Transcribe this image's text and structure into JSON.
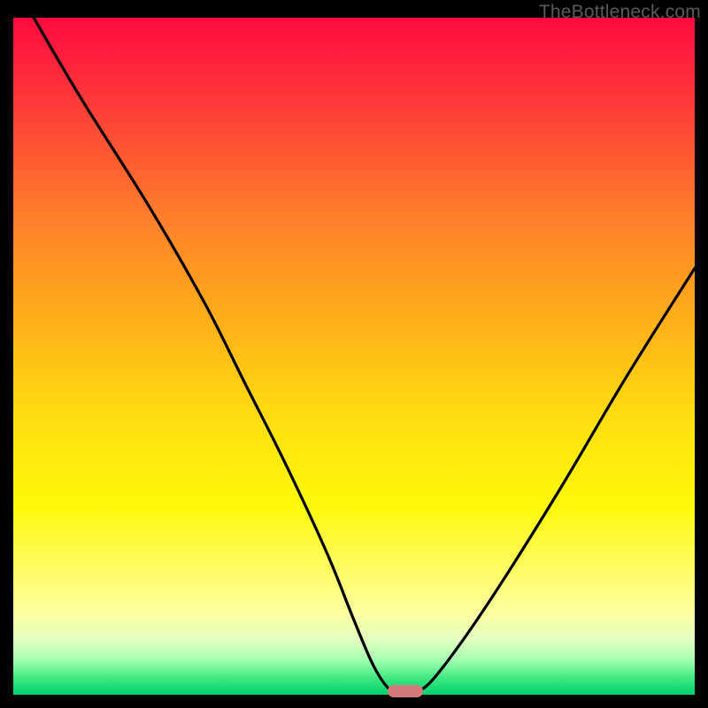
{
  "watermark": "TheBottleneck.com",
  "colors": {
    "gradient_top": "#ff0a3e",
    "gradient_bottom": "#00d070",
    "curve": "#000000",
    "marker": "#d47a7c",
    "frame": "#000000"
  },
  "chart_data": {
    "type": "line",
    "title": "",
    "xlabel": "",
    "ylabel": "",
    "xlim": [
      0,
      100
    ],
    "ylim": [
      0,
      100
    ],
    "grid": false,
    "series": [
      {
        "name": "bottleneck-curve",
        "x": [
          3,
          10,
          20,
          28,
          34,
          40,
          46,
          50,
          53,
          55.5,
          57,
          59.5,
          63,
          70,
          80,
          90,
          100
        ],
        "y": [
          100,
          88,
          72,
          58,
          46,
          34,
          21,
          11,
          4,
          0.5,
          0.5,
          0.5,
          4,
          14,
          30,
          47,
          63
        ]
      }
    ],
    "marker": {
      "x": 57.5,
      "y": 0.5,
      "shape": "rounded-rect"
    }
  }
}
